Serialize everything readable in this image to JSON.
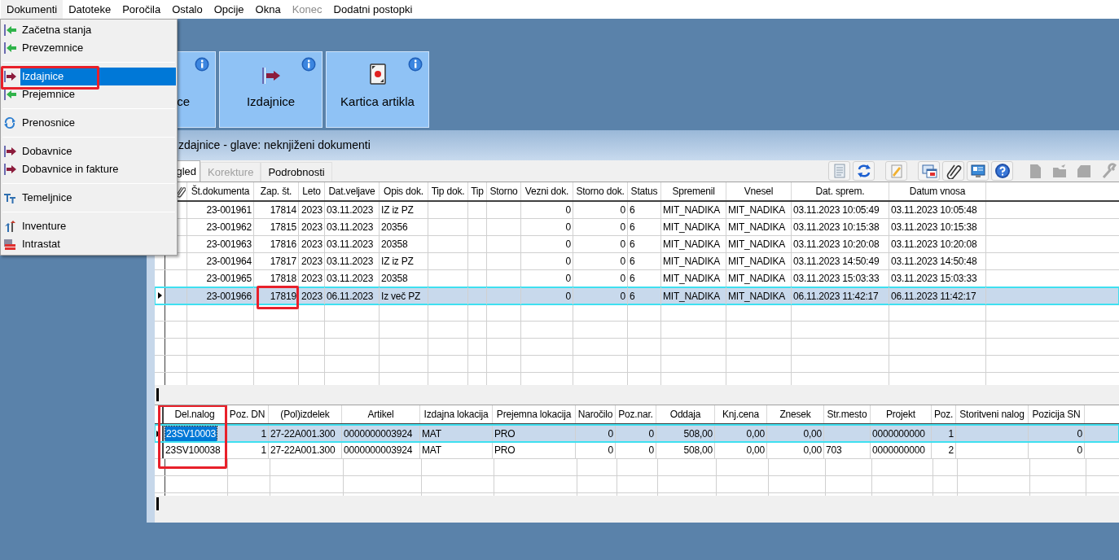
{
  "menubar": [
    {
      "label": "Dokumenti",
      "open": true,
      "disabled": false
    },
    {
      "label": "Datoteke",
      "open": false,
      "disabled": false
    },
    {
      "label": "Poročila",
      "open": false,
      "disabled": false
    },
    {
      "label": "Ostalo",
      "open": false,
      "disabled": false
    },
    {
      "label": "Opcije",
      "open": false,
      "disabled": false
    },
    {
      "label": "Okna",
      "open": false,
      "disabled": false
    },
    {
      "label": "Konec",
      "open": false,
      "disabled": true
    },
    {
      "label": "Dodatni postopki",
      "open": false,
      "disabled": false
    }
  ],
  "menu": {
    "groups": [
      [
        {
          "label": "Začetna stanja",
          "kind": "receipt",
          "selected": false,
          "annotated": false
        },
        {
          "label": "Prevzemnice",
          "kind": "receipt",
          "selected": false,
          "annotated": false
        }
      ],
      [
        {
          "label": "Izdajnice",
          "kind": "issue",
          "selected": true,
          "annotated": true
        },
        {
          "label": "Prejemnice",
          "kind": "receipt",
          "selected": false,
          "annotated": false
        }
      ],
      [
        {
          "label": "Prenosnice",
          "kind": "transfer",
          "selected": false,
          "annotated": false
        }
      ],
      [
        {
          "label": "Dobavnice",
          "kind": "issue",
          "selected": false,
          "annotated": false
        },
        {
          "label": "Dobavnice in fakture",
          "kind": "issue",
          "selected": false,
          "annotated": false
        }
      ],
      [
        {
          "label": "Temeljnice",
          "kind": "journal",
          "selected": false,
          "annotated": false
        }
      ],
      [
        {
          "label": "Inventure",
          "kind": "inventory",
          "selected": false,
          "annotated": false
        },
        {
          "label": "Intrastat",
          "kind": "intrastat",
          "selected": false,
          "annotated": false
        }
      ]
    ]
  },
  "tiles": [
    {
      "label": "ce"
    },
    {
      "label": "Izdajnice",
      "kind": "issue"
    },
    {
      "label": "Kartica artikla",
      "kind": "card"
    }
  ],
  "window": {
    "title": "zdajnice - glave: neknjiženi dokumenti",
    "tabs": [
      {
        "label": "gled",
        "selected": true,
        "disabled": false
      },
      {
        "label": "Korekture",
        "selected": false,
        "disabled": true
      },
      {
        "label": "Podrobnosti",
        "selected": false,
        "disabled": false
      }
    ],
    "toolbar": [
      {
        "kind": "report",
        "disabled": false
      },
      {
        "kind": "refresh",
        "disabled": false
      },
      {
        "kind": "edit",
        "disabled": false
      },
      {
        "kind": "windows",
        "disabled": false
      },
      {
        "kind": "attach",
        "disabled": false
      },
      {
        "kind": "monitor",
        "disabled": false
      },
      {
        "kind": "help",
        "disabled": false
      },
      {
        "kind": "page",
        "disabled": true
      },
      {
        "kind": "folder",
        "disabled": true
      },
      {
        "kind": "stack",
        "disabled": true
      },
      {
        "kind": "wrench",
        "disabled": true
      }
    ],
    "header_grid": {
      "columns": [
        "Št.dokumenta",
        "Zap. št.",
        "Leto",
        "Dat.veljave",
        "Opis dok.",
        "Tip dok.",
        "Tip",
        "Storno",
        "Vezni dok.",
        "Storno dok.",
        "Status",
        "Spremenil",
        "Vnesel",
        "Dat. sprem.",
        "Datum vnosa"
      ],
      "rows": [
        {
          "selected": false,
          "cells": [
            "23-001961",
            "17814",
            "2023",
            "03.11.2023",
            "IZ iz PZ",
            null,
            null,
            null,
            "0",
            "0",
            "6",
            "MIT_NADIKA",
            "MIT_NADIKA",
            "03.11.2023 10:05:49",
            "03.11.2023 10:05:48"
          ]
        },
        {
          "selected": false,
          "cells": [
            "23-001962",
            "17815",
            "2023",
            "03.11.2023",
            "20356",
            null,
            null,
            null,
            "0",
            "0",
            "6",
            "MIT_NADIKA",
            "MIT_NADIKA",
            "03.11.2023 10:15:38",
            "03.11.2023 10:15:38"
          ]
        },
        {
          "selected": false,
          "cells": [
            "23-001963",
            "17816",
            "2023",
            "03.11.2023",
            "20358",
            null,
            null,
            null,
            "0",
            "0",
            "6",
            "MIT_NADIKA",
            "MIT_NADIKA",
            "03.11.2023 10:20:08",
            "03.11.2023 10:20:08"
          ]
        },
        {
          "selected": false,
          "cells": [
            "23-001964",
            "17817",
            "2023",
            "03.11.2023",
            "IZ iz PZ",
            null,
            null,
            null,
            "0",
            "0",
            "6",
            "MIT_NADIKA",
            "MIT_NADIKA",
            "03.11.2023 14:50:49",
            "03.11.2023 14:50:48"
          ]
        },
        {
          "selected": false,
          "cells": [
            "23-001965",
            "17818",
            "2023",
            "03.11.2023",
            "20358",
            null,
            null,
            null,
            "0",
            "0",
            "6",
            "MIT_NADIKA",
            "MIT_NADIKA",
            "03.11.2023 15:03:33",
            "03.11.2023 15:03:33"
          ]
        },
        {
          "selected": true,
          "cells": [
            "23-001966",
            {
              "text": "17819",
              "annotated": true
            },
            "2023",
            "06.11.2023",
            "Iz več PZ",
            null,
            null,
            null,
            "0",
            "0",
            "6",
            "MIT_NADIKA",
            "MIT_NADIKA",
            "06.11.2023 11:42:17",
            "06.11.2023 11:42:17"
          ]
        }
      ]
    },
    "lines_grid": {
      "columns": [
        {
          "label": "Del.nalog",
          "annotated": true
        },
        {
          "label": "Poz. DN",
          "annotated": false
        },
        {
          "label": "(Pol)izdelek",
          "annotated": false
        },
        {
          "label": "Artikel",
          "annotated": false
        },
        {
          "label": "Izdajna lokacija",
          "annotated": false
        },
        {
          "label": "Prejemna lokacija",
          "annotated": false
        },
        {
          "label": "Naročilo",
          "annotated": false
        },
        {
          "label": "Poz.nar.",
          "annotated": false
        },
        {
          "label": "Oddaja",
          "annotated": false
        },
        {
          "label": "Knj.cena",
          "annotated": false
        },
        {
          "label": "Znesek",
          "annotated": false
        },
        {
          "label": "Str.mesto",
          "annotated": false
        },
        {
          "label": "Projekt",
          "annotated": false
        },
        {
          "label": "Poz.",
          "annotated": false
        },
        {
          "label": "Storitveni nalog",
          "annotated": false
        },
        {
          "label": "Pozicija SN",
          "annotated": false
        }
      ],
      "rows": [
        {
          "selected": true,
          "cells": [
            "23SV10003",
            "1",
            "27-22A001.300",
            "0000000003924",
            "MAT",
            "PRO",
            "0",
            "0",
            "508,00",
            "0,00",
            "0,00",
            null,
            "0000000000",
            "1",
            null,
            "0"
          ]
        },
        {
          "selected": false,
          "cells": [
            "23SV100038",
            "1",
            "27-22A001.300",
            "0000000003924",
            "MAT",
            "PRO",
            "0",
            "0",
            "508,00",
            "0,00",
            "0,00",
            "703",
            "0000000000",
            "2",
            null,
            "0"
          ]
        }
      ]
    }
  }
}
